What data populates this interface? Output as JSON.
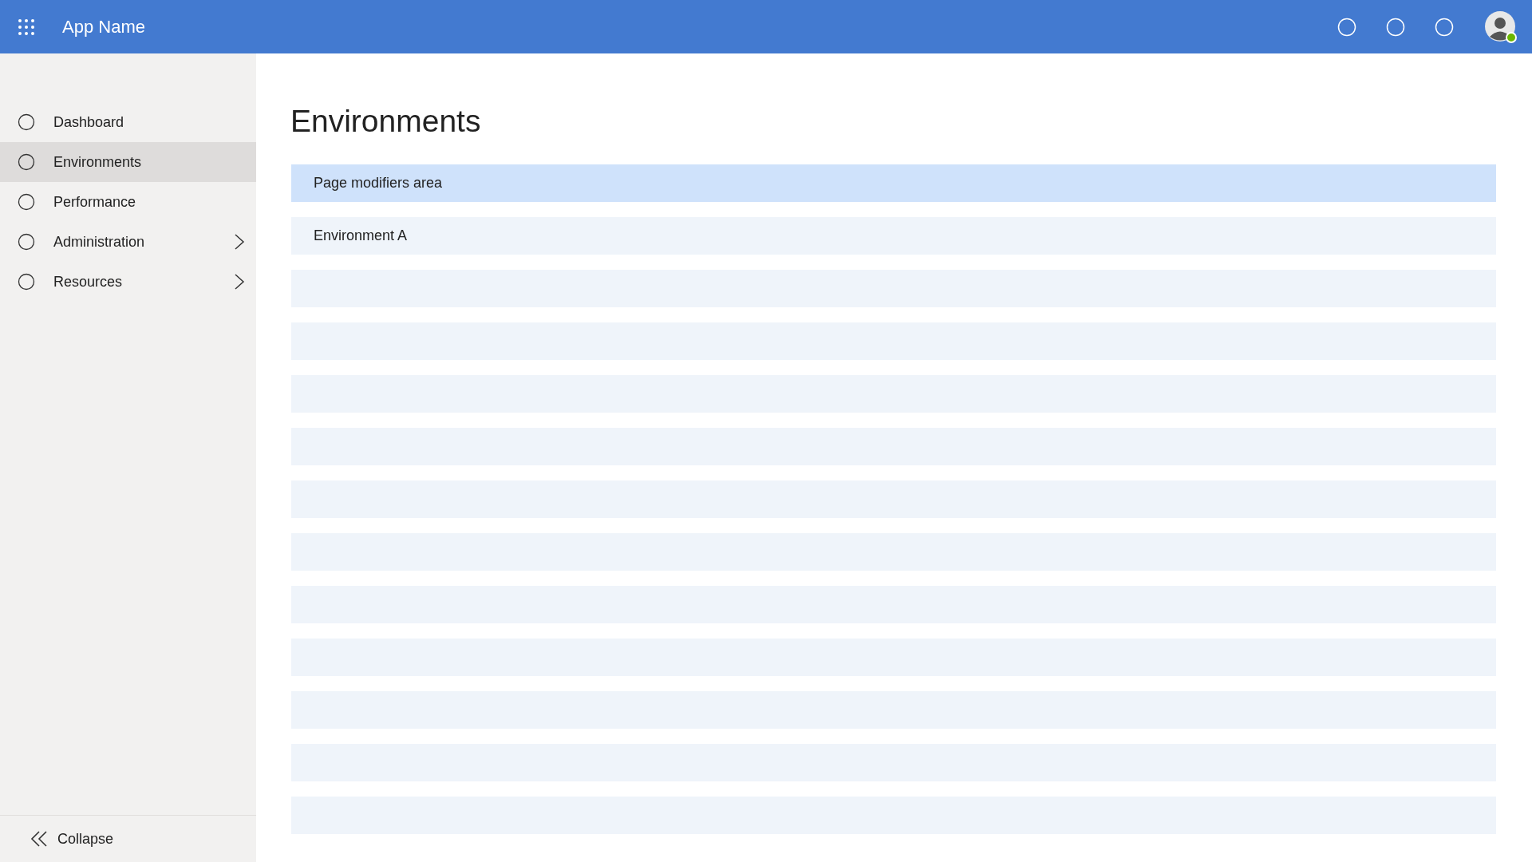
{
  "header": {
    "app_name": "App Name"
  },
  "sidebar": {
    "items": [
      {
        "label": "Dashboard",
        "kind": "link",
        "selected": false
      },
      {
        "label": "Environments",
        "kind": "link",
        "selected": true
      },
      {
        "label": "Performance",
        "kind": "link",
        "selected": false
      },
      {
        "label": "Administration",
        "kind": "group",
        "selected": false
      },
      {
        "label": "Resources",
        "kind": "group",
        "selected": false
      }
    ],
    "collapse": {
      "label": "Collapse"
    }
  },
  "page": {
    "title": "Environments",
    "modifiers_area": {
      "label": "Page modifiers area"
    },
    "rows": [
      {
        "kind": "item",
        "label": "Environment A"
      },
      {
        "kind": "empty"
      },
      {
        "kind": "empty"
      },
      {
        "kind": "empty"
      },
      {
        "kind": "empty"
      },
      {
        "kind": "empty"
      },
      {
        "kind": "empty"
      },
      {
        "kind": "empty"
      },
      {
        "kind": "empty"
      },
      {
        "kind": "empty"
      },
      {
        "kind": "empty"
      },
      {
        "kind": "empty"
      }
    ]
  }
}
